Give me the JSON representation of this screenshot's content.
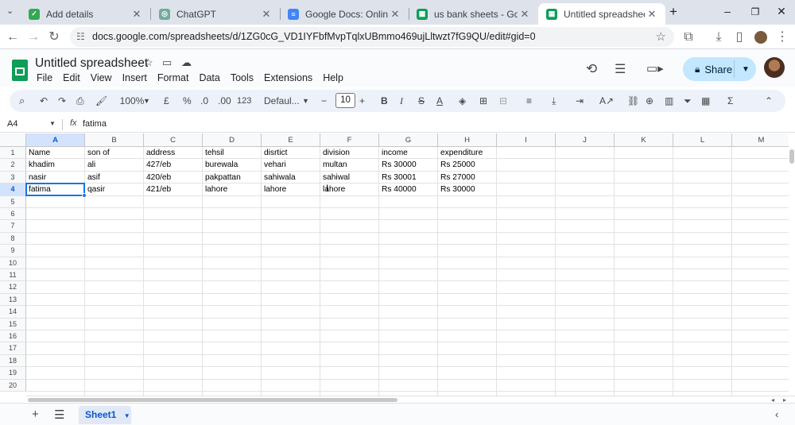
{
  "browser": {
    "tabs": [
      {
        "title": "Add details",
        "favicon_color": "#34a853",
        "favicon_glyph": "✓"
      },
      {
        "title": "ChatGPT",
        "favicon_color": "#74aa9c",
        "favicon_glyph": "◎"
      },
      {
        "title": "Google Docs: Online Docum",
        "favicon_color": "#4285f4",
        "favicon_glyph": "≡"
      },
      {
        "title": "us bank sheets - Google Sh",
        "favicon_color": "#0f9d58",
        "favicon_glyph": "▦"
      },
      {
        "title": "Untitled spreadsheet - Goog",
        "favicon_color": "#0f9d58",
        "favicon_glyph": "▦"
      }
    ],
    "url": "docs.google.com/spreadsheets/d/1ZG0cG_VD1IYFbfMvpTqlxUBmmo469ujLltwzt7fG9QU/edit#gid=0"
  },
  "app": {
    "title": "Untitled spreadsheet",
    "menu": [
      "File",
      "Edit",
      "View",
      "Insert",
      "Format",
      "Data",
      "Tools",
      "Extensions",
      "Help"
    ],
    "share_label": "Share"
  },
  "toolbar": {
    "zoom": "100%",
    "currency": "£",
    "percent": "%",
    "dec_decrease": ".0",
    "dec_increase": ".00",
    "number_format": "123",
    "font": "Defaul...",
    "font_size": "10"
  },
  "formula": {
    "cell_ref": "A4",
    "fx": "fx",
    "value": "fatima"
  },
  "grid": {
    "columns": [
      "A",
      "B",
      "C",
      "D",
      "E",
      "F",
      "G",
      "H",
      "I",
      "J",
      "K",
      "L",
      "M"
    ],
    "rows": [
      "1",
      "2",
      "3",
      "4",
      "5",
      "6",
      "7",
      "8",
      "9",
      "10",
      "11",
      "12",
      "13",
      "14",
      "15",
      "16",
      "17",
      "18",
      "19",
      "20"
    ],
    "cells": [
      [
        "Name",
        "son of",
        "address",
        "tehsil",
        "disrtict",
        "division",
        "income",
        "expenditure"
      ],
      [
        "khadim",
        "ali",
        "427/eb",
        "burewala",
        "vehari",
        "multan",
        "Rs 30000",
        "Rs 25000"
      ],
      [
        "nasir",
        "asif",
        "420/eb",
        "pakpattan",
        "sahiwala",
        "sahiwal",
        "Rs 30001",
        "Rs 27000"
      ],
      [
        "fatima",
        "qasir",
        "421/eb",
        "lahore",
        "lahore",
        "lahore",
        "Rs 40000",
        "Rs 30000"
      ]
    ],
    "selected_column": "A",
    "selected_row": "4"
  },
  "sheets": {
    "tabs": [
      "Sheet1"
    ]
  }
}
